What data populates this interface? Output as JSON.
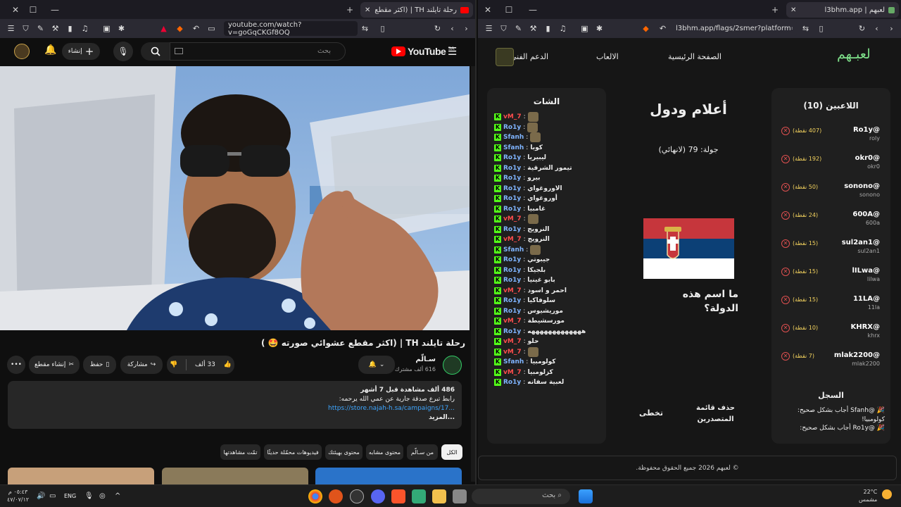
{
  "left_window": {
    "tab_title": "رحلة تايلند TH | (اكثر مقطع عش...",
    "url": "youtube.com/watch?v=goGqCKGf8OQ",
    "search_placeholder": "بحث",
    "logo": "YouTube",
    "logo_region": "SA",
    "create_label": "إنشاء",
    "video_title": "رحلة تايلند TH | (اكثر مقطع عشوائي صورته 🤩 )",
    "channel_name": "سـالّم",
    "channel_subs": "616 ألف مشترك",
    "like_count": "33 ألف",
    "share_label": "مشاركة",
    "save_label": "حفظ",
    "clip_label": "إنشاء مقطع",
    "desc_line1": "486 ألف مشاهدة  قبل 7 أشهر",
    "desc_line2": "رابط تبرع صدقة جارية عن عمي الله يرحمه:",
    "desc_link": "https://store.najah-h.sa/campaigns/17...",
    "desc_more": "...المزيد",
    "chips": [
      "الكل",
      "من سـالّم",
      "محتوى مشابه",
      "محتوى بهيئتك",
      "فيديوهات محمّلة حديثًا",
      "تمّت مشاهدتها"
    ]
  },
  "right_window": {
    "tab_title": "لعبهم | l3bhm.app",
    "url": "l3bhm.app/flags/2smer?platform=kick",
    "logo": "لعبـهم",
    "nav": [
      "الصفحة الرئيسية",
      "الالعاب",
      "الدعم الفني"
    ],
    "players_title": "اللاعبين (10)",
    "players": [
      {
        "name": "@Ro1y",
        "handle": "roly",
        "points": "(407 نقطة)"
      },
      {
        "name": "@okr0",
        "handle": "okr0",
        "points": "(192 نقطة)"
      },
      {
        "name": "@sonono",
        "handle": "sonono",
        "points": "(50 نقطة)"
      },
      {
        "name": "@600A",
        "handle": "600a",
        "points": "(24 نقطة)"
      },
      {
        "name": "@sul2an1",
        "handle": "sul2an1",
        "points": "(15 نقطة)"
      },
      {
        "name": "@lILwa",
        "handle": "lilwa",
        "points": "(15 نقطة)"
      },
      {
        "name": "@11LA",
        "handle": "11la",
        "points": "(15 نقطة)"
      },
      {
        "name": "@KHRX",
        "handle": "khrx",
        "points": "(10 نقطة)"
      },
      {
        "name": "@mlak2200",
        "handle": "mlak2200",
        "points": "(7 نقطة)"
      }
    ],
    "log_title": "السجل",
    "log": [
      "🎉 @Sfanh أجاب بشكل صحيح: كولومبيا!",
      "🎉 @Ro1y أجاب بشكل صحيح:"
    ],
    "game_title": "أعلام ودول",
    "round": "جولة: 79 (لانهائي)",
    "question": "ما اسم هذه الدولة؟",
    "btn_leaderboard_clear": "حذف قائمة المتصدرين",
    "btn_skip": "تخطى",
    "chat_title": "الشات",
    "chat": [
      {
        "user": "vM_7",
        "msg": "",
        "avatar": true,
        "red": true
      },
      {
        "user": "Ro1y",
        "msg": "",
        "avatar": true,
        "red": false
      },
      {
        "user": "Sfanh",
        "msg": "",
        "avatar": true,
        "red": false
      },
      {
        "user": "Sfanh",
        "msg": "كوبا",
        "red": false
      },
      {
        "user": "Ro1y",
        "msg": "ليبيريا",
        "red": false
      },
      {
        "user": "Ro1y",
        "msg": "تيمور الشرقية",
        "red": false
      },
      {
        "user": "Ro1y",
        "msg": "بيرو",
        "red": false
      },
      {
        "user": "Ro1y",
        "msg": "الاوروغواي",
        "red": false
      },
      {
        "user": "Ro1y",
        "msg": "أوروغواي",
        "red": false
      },
      {
        "user": "Ro1y",
        "msg": "غامبيا",
        "red": false
      },
      {
        "user": "vM_7",
        "msg": "",
        "avatar": true,
        "red": true
      },
      {
        "user": "Ro1y",
        "msg": "النرويج",
        "red": false
      },
      {
        "user": "vM_7",
        "msg": "النرويج",
        "red": true
      },
      {
        "user": "Sfanh",
        "msg": "",
        "avatar": true,
        "red": false
      },
      {
        "user": "Ro1y",
        "msg": "جيبوتي",
        "red": false
      },
      {
        "user": "Ro1y",
        "msg": "بلجيكا",
        "red": false
      },
      {
        "user": "Ro1y",
        "msg": "بابو غينيا",
        "red": false
      },
      {
        "user": "vM_7",
        "msg": "احمر و اسود",
        "red": true
      },
      {
        "user": "Ro1y",
        "msg": "سلوفاكيا",
        "red": false
      },
      {
        "user": "Ro1y",
        "msg": "موريشيوس",
        "red": false
      },
      {
        "user": "vM_7",
        "msg": "مورسشيطة",
        "red": true
      },
      {
        "user": "Ro1y",
        "msg": "هههههههههههههه",
        "red": false
      },
      {
        "user": "vM_7",
        "msg": "حلو",
        "red": true
      },
      {
        "user": "vM_7",
        "msg": "",
        "avatar": true,
        "red": true
      },
      {
        "user": "Sfanh",
        "msg": "كولومبيا",
        "red": false
      },
      {
        "user": "vM_7",
        "msg": "كزلومبيا",
        "red": true
      },
      {
        "user": "Ro1y",
        "msg": "لعبية سفانه",
        "red": false
      }
    ],
    "footer": "© لعبهم 2026 جميع الحقوق محفوظة."
  },
  "taskbar": {
    "search_placeholder": "بحث",
    "weather_temp": "22°C",
    "weather_desc": "مشمس",
    "lang": "ENG",
    "time": "٠٥:٤٣ م",
    "date": "٤٧/٠٧/١٢"
  },
  "colors": {
    "accent_kick": "#53fc18",
    "yt_red": "#ff0000",
    "chat_red": "#ff4d4d",
    "points": "#f4d35e"
  }
}
